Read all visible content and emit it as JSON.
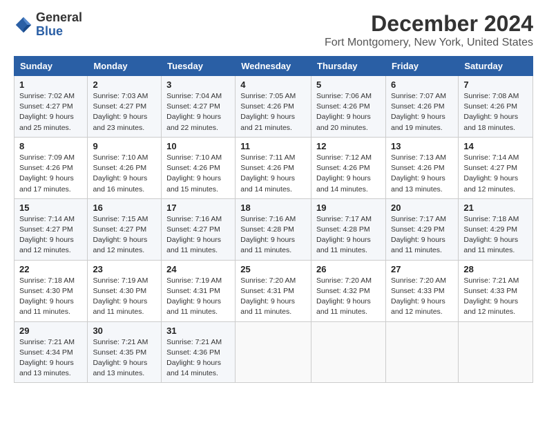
{
  "header": {
    "logo_line1": "General",
    "logo_line2": "Blue",
    "main_title": "December 2024",
    "subtitle": "Fort Montgomery, New York, United States"
  },
  "days_of_week": [
    "Sunday",
    "Monday",
    "Tuesday",
    "Wednesday",
    "Thursday",
    "Friday",
    "Saturday"
  ],
  "weeks": [
    [
      {
        "day": "1",
        "sunrise": "7:02 AM",
        "sunset": "4:27 PM",
        "daylight": "9 hours and 25 minutes."
      },
      {
        "day": "2",
        "sunrise": "7:03 AM",
        "sunset": "4:27 PM",
        "daylight": "9 hours and 23 minutes."
      },
      {
        "day": "3",
        "sunrise": "7:04 AM",
        "sunset": "4:27 PM",
        "daylight": "9 hours and 22 minutes."
      },
      {
        "day": "4",
        "sunrise": "7:05 AM",
        "sunset": "4:26 PM",
        "daylight": "9 hours and 21 minutes."
      },
      {
        "day": "5",
        "sunrise": "7:06 AM",
        "sunset": "4:26 PM",
        "daylight": "9 hours and 20 minutes."
      },
      {
        "day": "6",
        "sunrise": "7:07 AM",
        "sunset": "4:26 PM",
        "daylight": "9 hours and 19 minutes."
      },
      {
        "day": "7",
        "sunrise": "7:08 AM",
        "sunset": "4:26 PM",
        "daylight": "9 hours and 18 minutes."
      }
    ],
    [
      {
        "day": "8",
        "sunrise": "7:09 AM",
        "sunset": "4:26 PM",
        "daylight": "9 hours and 17 minutes."
      },
      {
        "day": "9",
        "sunrise": "7:10 AM",
        "sunset": "4:26 PM",
        "daylight": "9 hours and 16 minutes."
      },
      {
        "day": "10",
        "sunrise": "7:10 AM",
        "sunset": "4:26 PM",
        "daylight": "9 hours and 15 minutes."
      },
      {
        "day": "11",
        "sunrise": "7:11 AM",
        "sunset": "4:26 PM",
        "daylight": "9 hours and 14 minutes."
      },
      {
        "day": "12",
        "sunrise": "7:12 AM",
        "sunset": "4:26 PM",
        "daylight": "9 hours and 14 minutes."
      },
      {
        "day": "13",
        "sunrise": "7:13 AM",
        "sunset": "4:26 PM",
        "daylight": "9 hours and 13 minutes."
      },
      {
        "day": "14",
        "sunrise": "7:14 AM",
        "sunset": "4:27 PM",
        "daylight": "9 hours and 12 minutes."
      }
    ],
    [
      {
        "day": "15",
        "sunrise": "7:14 AM",
        "sunset": "4:27 PM",
        "daylight": "9 hours and 12 minutes."
      },
      {
        "day": "16",
        "sunrise": "7:15 AM",
        "sunset": "4:27 PM",
        "daylight": "9 hours and 12 minutes."
      },
      {
        "day": "17",
        "sunrise": "7:16 AM",
        "sunset": "4:27 PM",
        "daylight": "9 hours and 11 minutes."
      },
      {
        "day": "18",
        "sunrise": "7:16 AM",
        "sunset": "4:28 PM",
        "daylight": "9 hours and 11 minutes."
      },
      {
        "day": "19",
        "sunrise": "7:17 AM",
        "sunset": "4:28 PM",
        "daylight": "9 hours and 11 minutes."
      },
      {
        "day": "20",
        "sunrise": "7:17 AM",
        "sunset": "4:29 PM",
        "daylight": "9 hours and 11 minutes."
      },
      {
        "day": "21",
        "sunrise": "7:18 AM",
        "sunset": "4:29 PM",
        "daylight": "9 hours and 11 minutes."
      }
    ],
    [
      {
        "day": "22",
        "sunrise": "7:18 AM",
        "sunset": "4:30 PM",
        "daylight": "9 hours and 11 minutes."
      },
      {
        "day": "23",
        "sunrise": "7:19 AM",
        "sunset": "4:30 PM",
        "daylight": "9 hours and 11 minutes."
      },
      {
        "day": "24",
        "sunrise": "7:19 AM",
        "sunset": "4:31 PM",
        "daylight": "9 hours and 11 minutes."
      },
      {
        "day": "25",
        "sunrise": "7:20 AM",
        "sunset": "4:31 PM",
        "daylight": "9 hours and 11 minutes."
      },
      {
        "day": "26",
        "sunrise": "7:20 AM",
        "sunset": "4:32 PM",
        "daylight": "9 hours and 11 minutes."
      },
      {
        "day": "27",
        "sunrise": "7:20 AM",
        "sunset": "4:33 PM",
        "daylight": "9 hours and 12 minutes."
      },
      {
        "day": "28",
        "sunrise": "7:21 AM",
        "sunset": "4:33 PM",
        "daylight": "9 hours and 12 minutes."
      }
    ],
    [
      {
        "day": "29",
        "sunrise": "7:21 AM",
        "sunset": "4:34 PM",
        "daylight": "9 hours and 13 minutes."
      },
      {
        "day": "30",
        "sunrise": "7:21 AM",
        "sunset": "4:35 PM",
        "daylight": "9 hours and 13 minutes."
      },
      {
        "day": "31",
        "sunrise": "7:21 AM",
        "sunset": "4:36 PM",
        "daylight": "9 hours and 14 minutes."
      },
      null,
      null,
      null,
      null
    ]
  ],
  "labels": {
    "sunrise": "Sunrise:",
    "sunset": "Sunset:",
    "daylight": "Daylight:"
  }
}
